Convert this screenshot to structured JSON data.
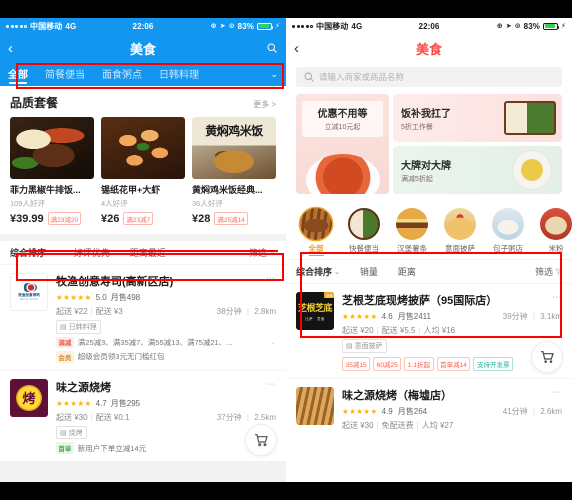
{
  "status_bar": {
    "carrier": "中国移动",
    "network": "4G",
    "time": "22:06",
    "battery": "83%"
  },
  "left_phone": {
    "nav": {
      "back_icon": "chevron-left-icon",
      "title": "美食",
      "search_icon": "search-icon"
    },
    "tabs": [
      {
        "label": "全部",
        "active": true
      },
      {
        "label": "简餐便当",
        "active": false
      },
      {
        "label": "面食粥点",
        "active": false
      },
      {
        "label": "日韩料理",
        "active": false
      }
    ],
    "tab_expand_icon": "chevron-down-icon",
    "section": {
      "title": "品质套餐",
      "more": "更多 >"
    },
    "dishes": [
      {
        "name": "菲力黑椒牛排饭...",
        "reviews": "109人好评",
        "price": "¥39.99",
        "promo": "满23减20"
      },
      {
        "name": "锡纸花甲+大虾",
        "reviews": "4人好评",
        "price": "¥26",
        "promo": "满23减7"
      },
      {
        "name": "黄焖鸡米饭经典...",
        "reviews": "36人好评",
        "price": "¥28",
        "promo": "满25减14"
      }
    ],
    "filters": [
      {
        "label": "综合排序",
        "caret": true
      },
      {
        "label": "好评优先",
        "caret": false
      },
      {
        "label": "距离最近",
        "caret": false
      },
      {
        "label": "筛选",
        "funnel": true
      }
    ],
    "shops": [
      {
        "name": "牧渔创意寿司(高新区店)",
        "logo_text_1": "牧渔创意寿司",
        "logo_text_2": "MUYU SUSHI",
        "stars": "★★★★★",
        "rating": "5.0",
        "sales": "月售498",
        "delivery_min": "起送 ¥22",
        "delivery_fee": "配送 ¥3",
        "time": "38分钟",
        "distance": "2.8km",
        "category_tag": "日韩料理",
        "promos": [
          {
            "badge": "满减",
            "type": "manjian",
            "text": "满25减3、满35减7、满55减13、满75减21、..."
          },
          {
            "badge": "会员",
            "type": "huiyuan",
            "text": "超级会员领3元无门槛红包"
          }
        ]
      },
      {
        "name": "味之源烧烤",
        "logo_text_1": "烤",
        "stars": "★★★★★",
        "rating": "4.7",
        "sales": "月售295",
        "delivery_min": "起送 ¥30",
        "delivery_fee": "配送 ¥0.1",
        "time": "37分钟",
        "distance": "2.5km",
        "category_tag": "烧烤",
        "promos": [
          {
            "badge": "首单",
            "type": "shoudan",
            "text": "新用户下单立减14元"
          }
        ]
      }
    ]
  },
  "right_phone": {
    "nav": {
      "back_icon": "chevron-left-icon",
      "title": "美食"
    },
    "search": {
      "icon": "search-icon",
      "placeholder": "请输入商家或商品名称",
      "value": ""
    },
    "banners": [
      {
        "title": "优惠不用等",
        "subtitle": "立减10元起"
      },
      {
        "title": "饭补我扛了",
        "subtitle": "5折工作餐"
      },
      {
        "title": "大牌对大牌",
        "subtitle": "满减5折起"
      }
    ],
    "categories": [
      {
        "label": "全部",
        "icon": "bbq-icon",
        "active": true
      },
      {
        "label": "快餐便当",
        "icon": "bento-icon",
        "active": false
      },
      {
        "label": "汉堡薯条",
        "icon": "burger-icon",
        "active": false
      },
      {
        "label": "意面披萨",
        "icon": "pizza-icon",
        "active": false
      },
      {
        "label": "包子粥店",
        "icon": "bao-icon",
        "active": false
      },
      {
        "label": "米粉",
        "icon": "noodle-icon",
        "active": false
      }
    ],
    "filters": [
      {
        "label": "综合排序",
        "caret": true
      },
      {
        "label": "销量",
        "caret": false
      },
      {
        "label": "距离",
        "caret": false
      },
      {
        "label": "筛选",
        "funnel": true
      }
    ],
    "shops": [
      {
        "name": "芝根芝底现烤披萨（95国际店）",
        "logo_text_1": "芝根芝底",
        "logo_text_2": "比萨 · 意面",
        "logo_corner": "品牌",
        "stars": "★★★★★",
        "rating": "4.6",
        "sales": "月售2411",
        "delivery_min": "起送 ¥20",
        "delivery_fee": "配送 ¥5.5",
        "avg": "人均 ¥16",
        "time": "39分钟",
        "distance": "3.1km",
        "category_tag": "意面披萨",
        "coupons": [
          "35减15",
          "60减25",
          "1.1折起",
          "首单减14",
          "支持开发票"
        ]
      },
      {
        "name": "味之源烧烤（梅墟店）",
        "stars": "★★★★★",
        "rating": "4.9",
        "sales": "月售264",
        "delivery_min": "起送 ¥30",
        "delivery_fee": "免配送费",
        "avg": "人均 ¥27",
        "time": "41分钟",
        "distance": "2.6km"
      }
    ]
  },
  "annotations": {
    "box_color": "#ff0000",
    "boxes": [
      {
        "name": "left-category-tabs-highlight"
      },
      {
        "name": "left-quality-set-meal-highlight"
      },
      {
        "name": "left-sort-filter-bar-highlight"
      },
      {
        "name": "right-category-and-filter-highlight"
      }
    ]
  }
}
